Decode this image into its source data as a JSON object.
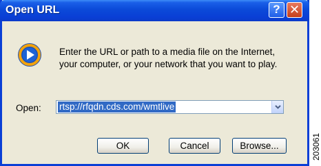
{
  "window": {
    "title": "Open URL",
    "help_label": "?",
    "close_label": "✕"
  },
  "dialog": {
    "icon": "windows-media-player-icon",
    "message_line1": "Enter the URL or path to a media file on the Internet,",
    "message_line2": "your computer, or your network that you want to play.",
    "open_label": "Open:",
    "open_value": "rtsp://rfqdn.cds.com/wmtlive",
    "ok_label": "OK",
    "cancel_label": "Cancel",
    "browse_label": "Browse..."
  },
  "side_code": "203061",
  "colors": {
    "titlebar": "#0a3fd6",
    "dialog_bg": "#ece9d8",
    "selection": "#316ac5",
    "close_button": "#c53f1c"
  }
}
